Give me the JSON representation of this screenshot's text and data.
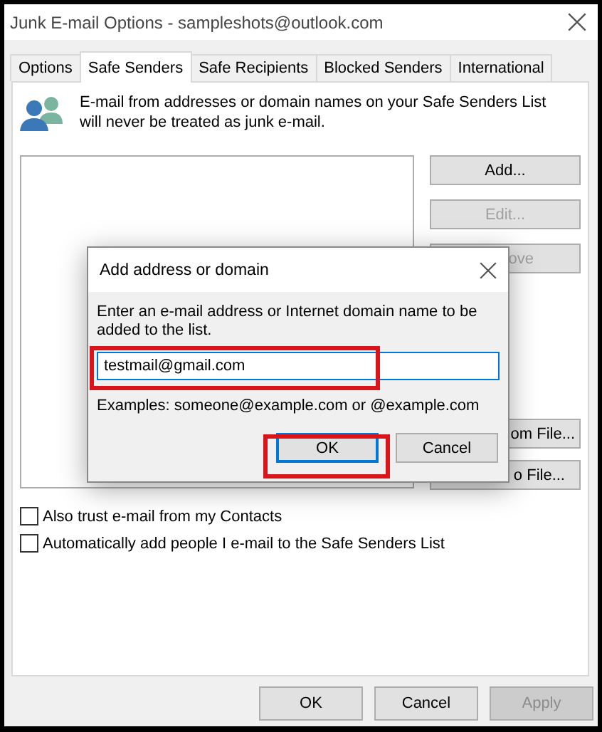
{
  "window": {
    "title": "Junk E-mail Options - sampleshots@outlook.com"
  },
  "tabs": [
    {
      "label": "Options",
      "selected": false
    },
    {
      "label": "Safe Senders",
      "selected": true
    },
    {
      "label": "Safe Recipients",
      "selected": false
    },
    {
      "label": "Blocked Senders",
      "selected": false
    },
    {
      "label": "International",
      "selected": false
    }
  ],
  "description": "E-mail from addresses or domain names on your Safe Senders List will never be treated as junk e-mail.",
  "list_buttons": [
    {
      "label": "Add...",
      "disabled": false
    },
    {
      "label": "Edit...",
      "disabled": true
    },
    {
      "label": "ove",
      "disabled": true
    }
  ],
  "file_buttons": [
    {
      "label": "om File...",
      "disabled": false
    },
    {
      "label": "o File...",
      "disabled": false
    }
  ],
  "checkboxes": [
    {
      "label": "Also trust e-mail from my Contacts",
      "checked": false
    },
    {
      "label": "Automatically add people I e-mail to the Safe Senders List",
      "checked": false
    }
  ],
  "footer_buttons": [
    {
      "label": "OK",
      "disabled": false
    },
    {
      "label": "Cancel",
      "disabled": false
    },
    {
      "label": "Apply",
      "disabled": true
    }
  ],
  "dialog": {
    "title": "Add address or domain",
    "prompt": "Enter an e-mail address or Internet domain name to be added to the list.",
    "field": {
      "value": "testmail@gmail.com",
      "highlighted": true
    },
    "examples": "Examples: someone@example.com or @example.com",
    "buttons": [
      {
        "label": "OK",
        "default": true,
        "highlighted": true
      },
      {
        "label": "Cancel",
        "default": false,
        "highlighted": false
      }
    ]
  }
}
